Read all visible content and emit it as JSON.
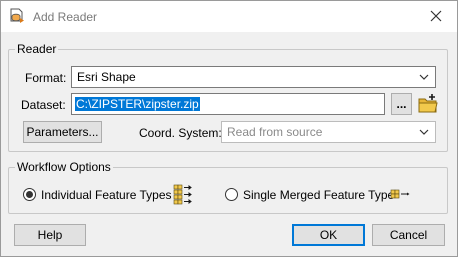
{
  "window": {
    "title": "Add Reader",
    "icon": "add-reader-icon"
  },
  "reader": {
    "group_label": "Reader",
    "format_label": "Format:",
    "format_value": "Esri Shape",
    "dataset_label": "Dataset:",
    "dataset_value": "C:\\ZIPSTER\\zipster.zip",
    "browse_label": "...",
    "parameters_label": "Parameters...",
    "coord_label": "Coord. System:",
    "coord_value": "Read from source"
  },
  "workflow": {
    "group_label": "Workflow Options",
    "option_individual": "Individual Feature Types",
    "option_merged": "Single Merged Feature Type",
    "selected": "individual"
  },
  "footer": {
    "help": "Help",
    "ok": "OK",
    "cancel": "Cancel"
  },
  "colors": {
    "accent": "#0078d7",
    "folder": "#f2c94c",
    "icon_orange": "#d97a1a"
  }
}
